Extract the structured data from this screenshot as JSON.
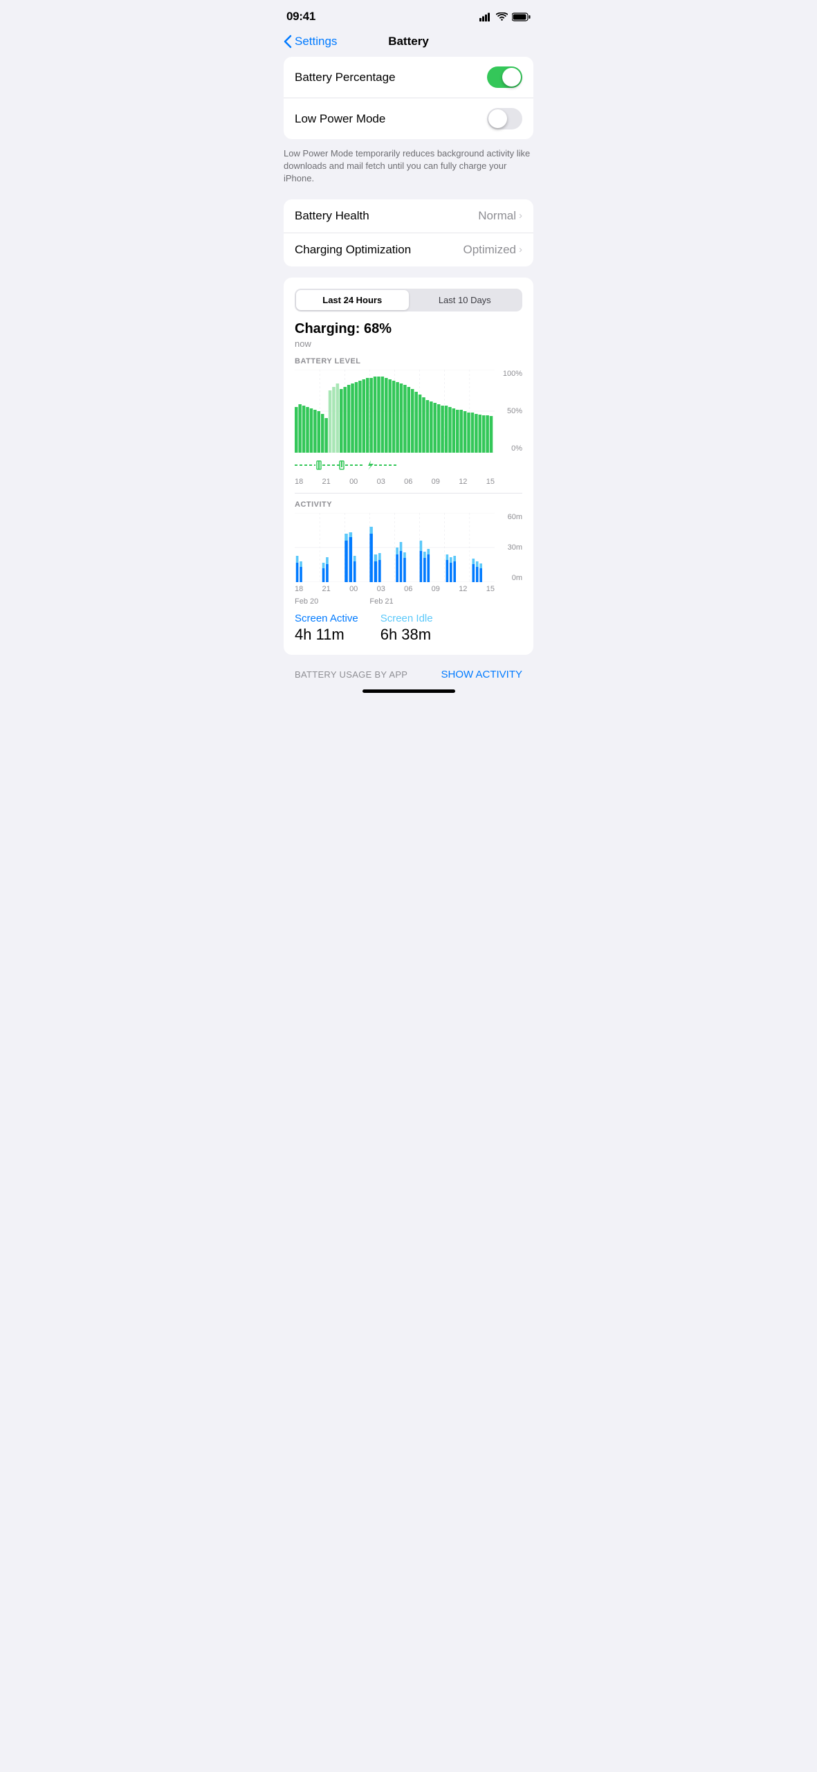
{
  "statusBar": {
    "time": "09:41",
    "signal": "signal-icon",
    "wifi": "wifi-icon",
    "battery": "battery-icon"
  },
  "nav": {
    "backLabel": "Settings",
    "title": "Battery"
  },
  "settings": {
    "batteryPercentage": {
      "label": "Battery Percentage",
      "enabled": true
    },
    "lowPowerMode": {
      "label": "Low Power Mode",
      "enabled": false,
      "description": "Low Power Mode temporarily reduces background activity like downloads and mail fetch until you can fully charge your iPhone."
    }
  },
  "healthSection": {
    "batteryHealth": {
      "label": "Battery Health",
      "value": "Normal"
    },
    "chargingOptimization": {
      "label": "Charging Optimization",
      "value": "Optimized"
    }
  },
  "usageSection": {
    "timeToggle": {
      "option1": "Last 24 Hours",
      "option2": "Last 10 Days",
      "activeIndex": 0
    },
    "charging": {
      "label": "Charging: 68%",
      "time": "now"
    },
    "batteryChart": {
      "sectionLabel": "BATTERY LEVEL",
      "yLabels": [
        "100%",
        "50%",
        "0%"
      ],
      "xLabels": [
        "18",
        "21",
        "00",
        "03",
        "06",
        "09",
        "12",
        "15"
      ]
    },
    "activityChart": {
      "sectionLabel": "ACTIVITY",
      "yLabels": [
        "60m",
        "30m",
        "0m"
      ],
      "xLabels": [
        "18",
        "21",
        "00",
        "03",
        "06",
        "09",
        "12",
        "15"
      ],
      "dateLabels": [
        "Feb 20",
        "",
        "Feb 21",
        "",
        "",
        "",
        "",
        ""
      ]
    },
    "screenActive": {
      "label": "Screen Active",
      "value": "4h 11m"
    },
    "screenIdle": {
      "label": "Screen Idle",
      "value": "6h 38m"
    }
  },
  "footer": {
    "usageByApp": "BATTERY USAGE BY APP",
    "showActivity": "SHOW ACTIVITY"
  }
}
